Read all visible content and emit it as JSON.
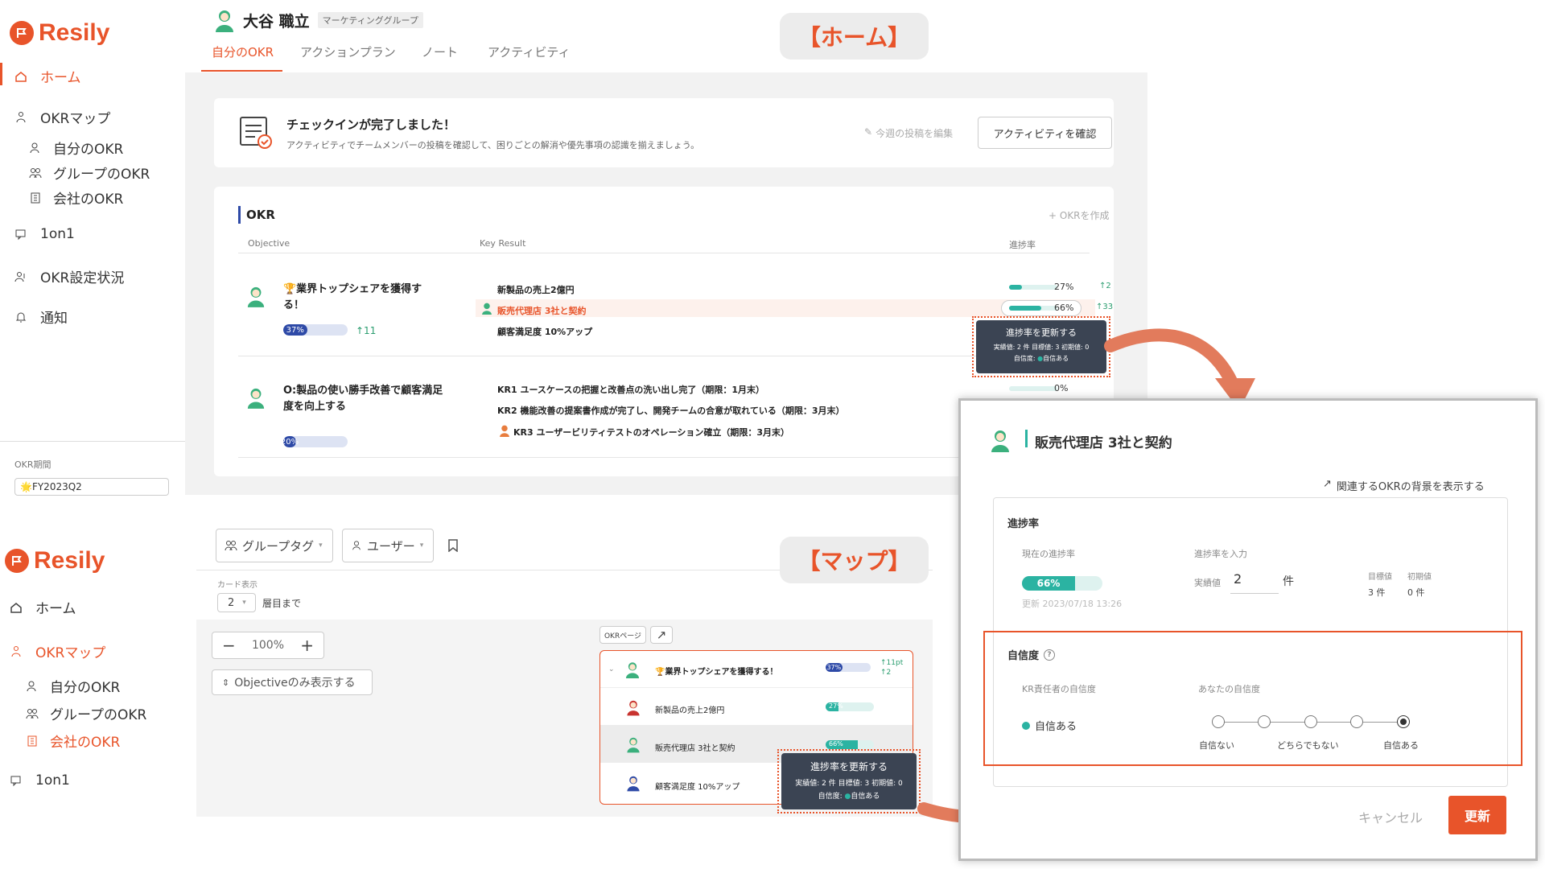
{
  "brand": {
    "name": "Resily",
    "color": "#e8542a"
  },
  "top": {
    "sidebar": {
      "home": "ホーム",
      "okr_map": "OKRマップ",
      "my_okr": "自分のOKR",
      "group_okr": "グループのOKR",
      "company_okr": "会社のOKR",
      "oneonone": "1on1",
      "okr_status": "OKR設定状況",
      "notify": "通知",
      "period_label": "OKR期間",
      "period_value": "FY2023Q2"
    },
    "user": {
      "name": "大谷 職立",
      "group": "マーケティンググループ"
    },
    "tabs": [
      "自分のOKR",
      "アクションプラン",
      "ノート",
      "アクティビティ"
    ],
    "screen_label": "【ホーム】",
    "checkin": {
      "title": "チェックインが完了しました！",
      "desc": "アクティビティでチームメンバーの投稿を確認して、困りごとの解消や優先事項の認識を揃えましょう。",
      "edit": "今週の投稿を編集",
      "button": "アクティビティを確認"
    },
    "okr": {
      "title": "OKR",
      "create": "+ OKRを作成",
      "col_objective": "Objective",
      "col_kr": "Key Result",
      "col_progress": "進捗率",
      "objectives": [
        {
          "title": "🏆業界トップシェアを獲得する！",
          "progress": 37,
          "progress_label": "37%",
          "delta": "↑11",
          "krs": [
            {
              "label": "新製品の売上2億円",
              "progress": 27,
              "progress_label": "27%",
              "delta": "↑2"
            },
            {
              "label": "販売代理店 3社と契約",
              "progress": 66,
              "progress_label": "66%",
              "delta": "↑33"
            },
            {
              "label": "顧客満足度 10%アップ"
            }
          ]
        },
        {
          "title": "O:製品の使い勝手改善で顧客満足度を向上する",
          "progress": 20,
          "progress_label": "20%",
          "krs": [
            {
              "label": "KR1 ユースケースの把握と改善点の洗い出し完了（期限：1月末）",
              "progress": 0,
              "progress_label": "0%"
            },
            {
              "label": "KR2 機能改善の提案書作成が完了し、開発チームの合意が取れている（期限：3月末）"
            },
            {
              "label": "KR3 ユーザービリティテストのオペレーション確立（期限：3月末）"
            }
          ]
        }
      ]
    },
    "tooltip": {
      "title": "進捗率を更新する",
      "line1": "実績値: 2 件 目標値: 3 初期値: 0",
      "line2_prefix": "自信度:",
      "line2_value": "自信ある"
    }
  },
  "map": {
    "sidebar": {
      "home": "ホーム",
      "okr_map": "OKRマップ",
      "my_okr": "自分のOKR",
      "group_okr": "グループのOKR",
      "company_okr": "会社のOKR",
      "oneonone": "1on1"
    },
    "filters": {
      "group_tag": "グループタグ",
      "user": "ユーザー"
    },
    "card_display_label": "カード表示",
    "card_depth": "2",
    "card_depth_suffix": "層目まで",
    "zoom": "100%",
    "objective_only": "Objectiveのみ表示する",
    "screen_label": "【マップ】",
    "okr_page_btn": "OKRページ",
    "card": {
      "objective": "🏆業界トップシェアを獲得する！",
      "obj_progress": 37,
      "obj_progress_label": "37%",
      "obj_delta1": "↑11pt",
      "obj_delta2": "↑2",
      "krs": [
        {
          "label": "新製品の売上2億円",
          "progress": 27,
          "progress_label": "27%"
        },
        {
          "label": "販売代理店 3社と契約",
          "progress": 66,
          "progress_label": "66%"
        },
        {
          "label": "顧客満足度 10%アップ"
        }
      ]
    },
    "tooltip": {
      "title": "進捗率を更新する",
      "line1": "実績値: 2 件 目標値: 3 初期値: 0",
      "line2_prefix": "自信度:",
      "line2_value": "自信ある"
    }
  },
  "modal": {
    "title": "販売代理店 3社と契約",
    "related": "関連するOKRの背景を表示する",
    "progress_section": "進捗率",
    "current_label": "現在の進捗率",
    "current_value": "66%",
    "current_fraction": 0.66,
    "updated": "更新 2023/07/18 13:26",
    "input_label": "進捗率を入力",
    "actual_label": "実績値",
    "actual_value": "2",
    "unit": "件",
    "target_label": "目標値",
    "target_value": "3 件",
    "initial_label": "初期値",
    "initial_value": "0 件",
    "confidence_section": "自信度",
    "owner_conf_label": "KR責任者の自信度",
    "owner_conf_value": "自信ある",
    "your_conf_label": "あなたの自信度",
    "scale": [
      "自信ない",
      "",
      "どちらでもない",
      "",
      "自信ある"
    ],
    "selected_index": 4,
    "cancel": "キャンセル",
    "update": "更新"
  }
}
